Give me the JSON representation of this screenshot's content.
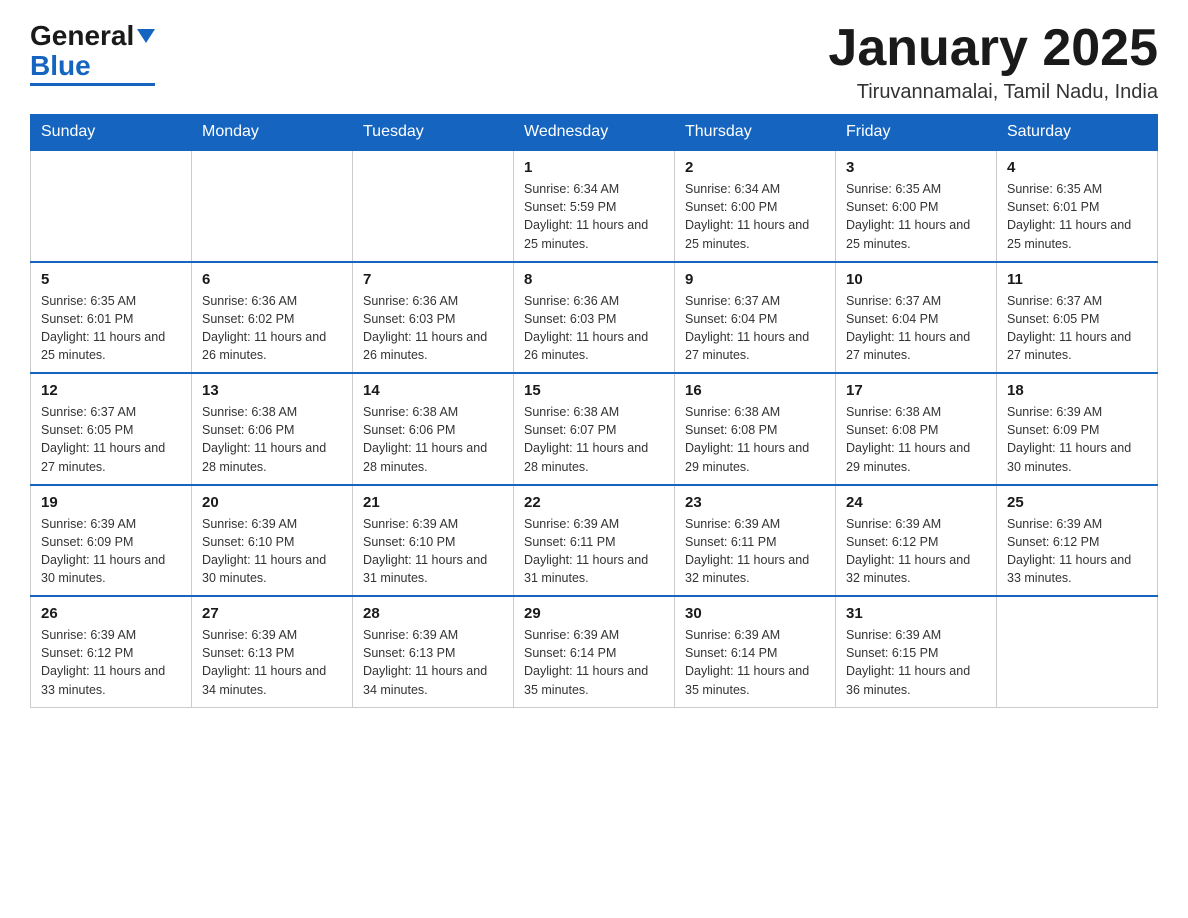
{
  "header": {
    "logo_general": "General",
    "logo_blue": "Blue",
    "month_title": "January 2025",
    "location": "Tiruvannamalai, Tamil Nadu, India"
  },
  "days_of_week": [
    "Sunday",
    "Monday",
    "Tuesday",
    "Wednesday",
    "Thursday",
    "Friday",
    "Saturday"
  ],
  "weeks": [
    [
      {
        "day": "",
        "sunrise": "",
        "sunset": "",
        "daylight": ""
      },
      {
        "day": "",
        "sunrise": "",
        "sunset": "",
        "daylight": ""
      },
      {
        "day": "",
        "sunrise": "",
        "sunset": "",
        "daylight": ""
      },
      {
        "day": "1",
        "sunrise": "Sunrise: 6:34 AM",
        "sunset": "Sunset: 5:59 PM",
        "daylight": "Daylight: 11 hours and 25 minutes."
      },
      {
        "day": "2",
        "sunrise": "Sunrise: 6:34 AM",
        "sunset": "Sunset: 6:00 PM",
        "daylight": "Daylight: 11 hours and 25 minutes."
      },
      {
        "day": "3",
        "sunrise": "Sunrise: 6:35 AM",
        "sunset": "Sunset: 6:00 PM",
        "daylight": "Daylight: 11 hours and 25 minutes."
      },
      {
        "day": "4",
        "sunrise": "Sunrise: 6:35 AM",
        "sunset": "Sunset: 6:01 PM",
        "daylight": "Daylight: 11 hours and 25 minutes."
      }
    ],
    [
      {
        "day": "5",
        "sunrise": "Sunrise: 6:35 AM",
        "sunset": "Sunset: 6:01 PM",
        "daylight": "Daylight: 11 hours and 25 minutes."
      },
      {
        "day": "6",
        "sunrise": "Sunrise: 6:36 AM",
        "sunset": "Sunset: 6:02 PM",
        "daylight": "Daylight: 11 hours and 26 minutes."
      },
      {
        "day": "7",
        "sunrise": "Sunrise: 6:36 AM",
        "sunset": "Sunset: 6:03 PM",
        "daylight": "Daylight: 11 hours and 26 minutes."
      },
      {
        "day": "8",
        "sunrise": "Sunrise: 6:36 AM",
        "sunset": "Sunset: 6:03 PM",
        "daylight": "Daylight: 11 hours and 26 minutes."
      },
      {
        "day": "9",
        "sunrise": "Sunrise: 6:37 AM",
        "sunset": "Sunset: 6:04 PM",
        "daylight": "Daylight: 11 hours and 27 minutes."
      },
      {
        "day": "10",
        "sunrise": "Sunrise: 6:37 AM",
        "sunset": "Sunset: 6:04 PM",
        "daylight": "Daylight: 11 hours and 27 minutes."
      },
      {
        "day": "11",
        "sunrise": "Sunrise: 6:37 AM",
        "sunset": "Sunset: 6:05 PM",
        "daylight": "Daylight: 11 hours and 27 minutes."
      }
    ],
    [
      {
        "day": "12",
        "sunrise": "Sunrise: 6:37 AM",
        "sunset": "Sunset: 6:05 PM",
        "daylight": "Daylight: 11 hours and 27 minutes."
      },
      {
        "day": "13",
        "sunrise": "Sunrise: 6:38 AM",
        "sunset": "Sunset: 6:06 PM",
        "daylight": "Daylight: 11 hours and 28 minutes."
      },
      {
        "day": "14",
        "sunrise": "Sunrise: 6:38 AM",
        "sunset": "Sunset: 6:06 PM",
        "daylight": "Daylight: 11 hours and 28 minutes."
      },
      {
        "day": "15",
        "sunrise": "Sunrise: 6:38 AM",
        "sunset": "Sunset: 6:07 PM",
        "daylight": "Daylight: 11 hours and 28 minutes."
      },
      {
        "day": "16",
        "sunrise": "Sunrise: 6:38 AM",
        "sunset": "Sunset: 6:08 PM",
        "daylight": "Daylight: 11 hours and 29 minutes."
      },
      {
        "day": "17",
        "sunrise": "Sunrise: 6:38 AM",
        "sunset": "Sunset: 6:08 PM",
        "daylight": "Daylight: 11 hours and 29 minutes."
      },
      {
        "day": "18",
        "sunrise": "Sunrise: 6:39 AM",
        "sunset": "Sunset: 6:09 PM",
        "daylight": "Daylight: 11 hours and 30 minutes."
      }
    ],
    [
      {
        "day": "19",
        "sunrise": "Sunrise: 6:39 AM",
        "sunset": "Sunset: 6:09 PM",
        "daylight": "Daylight: 11 hours and 30 minutes."
      },
      {
        "day": "20",
        "sunrise": "Sunrise: 6:39 AM",
        "sunset": "Sunset: 6:10 PM",
        "daylight": "Daylight: 11 hours and 30 minutes."
      },
      {
        "day": "21",
        "sunrise": "Sunrise: 6:39 AM",
        "sunset": "Sunset: 6:10 PM",
        "daylight": "Daylight: 11 hours and 31 minutes."
      },
      {
        "day": "22",
        "sunrise": "Sunrise: 6:39 AM",
        "sunset": "Sunset: 6:11 PM",
        "daylight": "Daylight: 11 hours and 31 minutes."
      },
      {
        "day": "23",
        "sunrise": "Sunrise: 6:39 AM",
        "sunset": "Sunset: 6:11 PM",
        "daylight": "Daylight: 11 hours and 32 minutes."
      },
      {
        "day": "24",
        "sunrise": "Sunrise: 6:39 AM",
        "sunset": "Sunset: 6:12 PM",
        "daylight": "Daylight: 11 hours and 32 minutes."
      },
      {
        "day": "25",
        "sunrise": "Sunrise: 6:39 AM",
        "sunset": "Sunset: 6:12 PM",
        "daylight": "Daylight: 11 hours and 33 minutes."
      }
    ],
    [
      {
        "day": "26",
        "sunrise": "Sunrise: 6:39 AM",
        "sunset": "Sunset: 6:12 PM",
        "daylight": "Daylight: 11 hours and 33 minutes."
      },
      {
        "day": "27",
        "sunrise": "Sunrise: 6:39 AM",
        "sunset": "Sunset: 6:13 PM",
        "daylight": "Daylight: 11 hours and 34 minutes."
      },
      {
        "day": "28",
        "sunrise": "Sunrise: 6:39 AM",
        "sunset": "Sunset: 6:13 PM",
        "daylight": "Daylight: 11 hours and 34 minutes."
      },
      {
        "day": "29",
        "sunrise": "Sunrise: 6:39 AM",
        "sunset": "Sunset: 6:14 PM",
        "daylight": "Daylight: 11 hours and 35 minutes."
      },
      {
        "day": "30",
        "sunrise": "Sunrise: 6:39 AM",
        "sunset": "Sunset: 6:14 PM",
        "daylight": "Daylight: 11 hours and 35 minutes."
      },
      {
        "day": "31",
        "sunrise": "Sunrise: 6:39 AM",
        "sunset": "Sunset: 6:15 PM",
        "daylight": "Daylight: 11 hours and 36 minutes."
      },
      {
        "day": "",
        "sunrise": "",
        "sunset": "",
        "daylight": ""
      }
    ]
  ]
}
